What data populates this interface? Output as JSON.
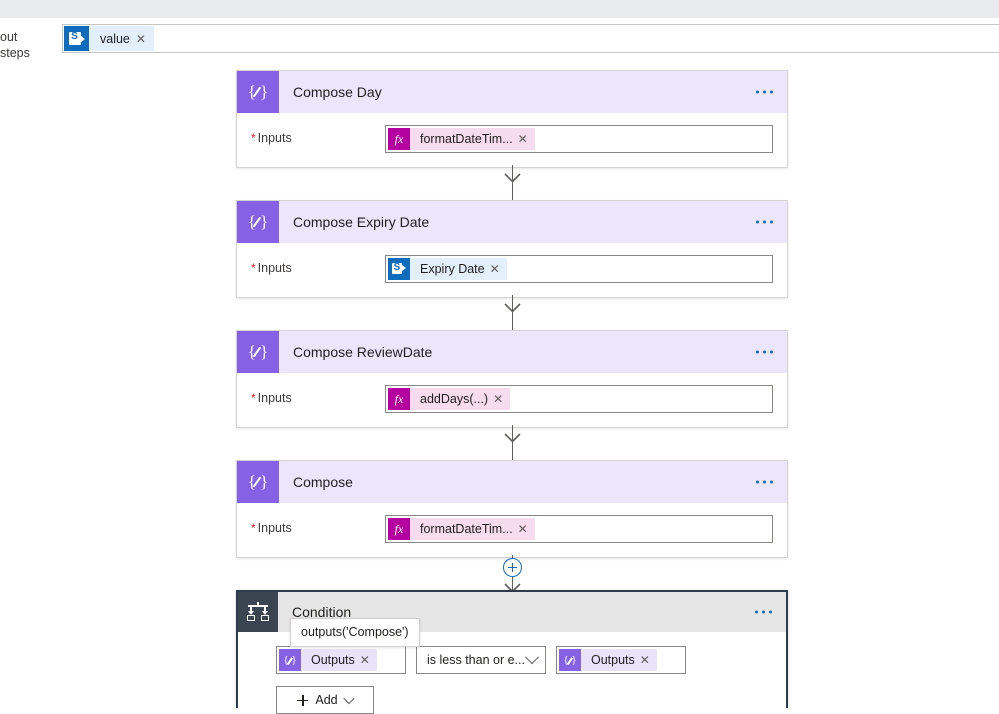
{
  "left_rail": {
    "lines": [
      "out",
      "steps"
    ]
  },
  "token_bar": {
    "chip": {
      "icon": "sharepoint-icon",
      "label": "value",
      "remove": "✕"
    }
  },
  "cards": [
    {
      "icon": "compose-icon",
      "title": "Compose Day",
      "menu": "more-options",
      "field_label": "Inputs",
      "required": true,
      "token": {
        "kind": "expression",
        "icon": "fx-icon",
        "label": "formatDateTim...",
        "remove": "✕"
      }
    },
    {
      "icon": "compose-icon",
      "title": "Compose Expiry Date",
      "menu": "more-options",
      "field_label": "Inputs",
      "required": true,
      "token": {
        "kind": "sharepoint",
        "icon": "sharepoint-icon",
        "label": "Expiry Date",
        "remove": "✕"
      }
    },
    {
      "icon": "compose-icon",
      "title": "Compose ReviewDate",
      "menu": "more-options",
      "field_label": "Inputs",
      "required": true,
      "token": {
        "kind": "expression",
        "icon": "fx-icon",
        "label": "addDays(...)",
        "remove": "✕"
      }
    },
    {
      "icon": "compose-icon",
      "title": "Compose",
      "menu": "more-options",
      "field_label": "Inputs",
      "required": true,
      "token": {
        "kind": "expression",
        "icon": "fx-icon",
        "label": "formatDateTim...",
        "remove": "✕"
      }
    }
  ],
  "insert_node": {
    "label": "+",
    "name": "insert-step-button"
  },
  "condition": {
    "icon": "condition-icon",
    "title": "Condition",
    "menu": "more-options",
    "tooltip": "outputs('Compose')",
    "left_operand": {
      "icon": "outputs-icon",
      "label": "Outputs",
      "remove": "✕"
    },
    "operator": {
      "value": "is less than or e...",
      "chevron": "chevron-down-icon"
    },
    "right_operand": {
      "icon": "outputs-icon",
      "label": "Outputs",
      "remove": "✕"
    },
    "add_button": {
      "label": "Add",
      "chevron": "chevron-down-icon"
    }
  },
  "colors": {
    "compose_accent": "#8661e5",
    "compose_header": "#ebe6fb",
    "expression_accent": "#b4009e",
    "expression_chip_bg": "#f7dbef",
    "sharepoint_accent": "#0f6cbd",
    "sharepoint_chip_bg": "#e3effb",
    "outputs_chip_bg": "#e8e2fb",
    "condition_accent": "#3b4552",
    "condition_header": "#e6e6e6",
    "selection_border": "#2f3b4a",
    "required_star": "#e81123",
    "connector": "#605e5c",
    "top_band": "#e9eaee"
  }
}
